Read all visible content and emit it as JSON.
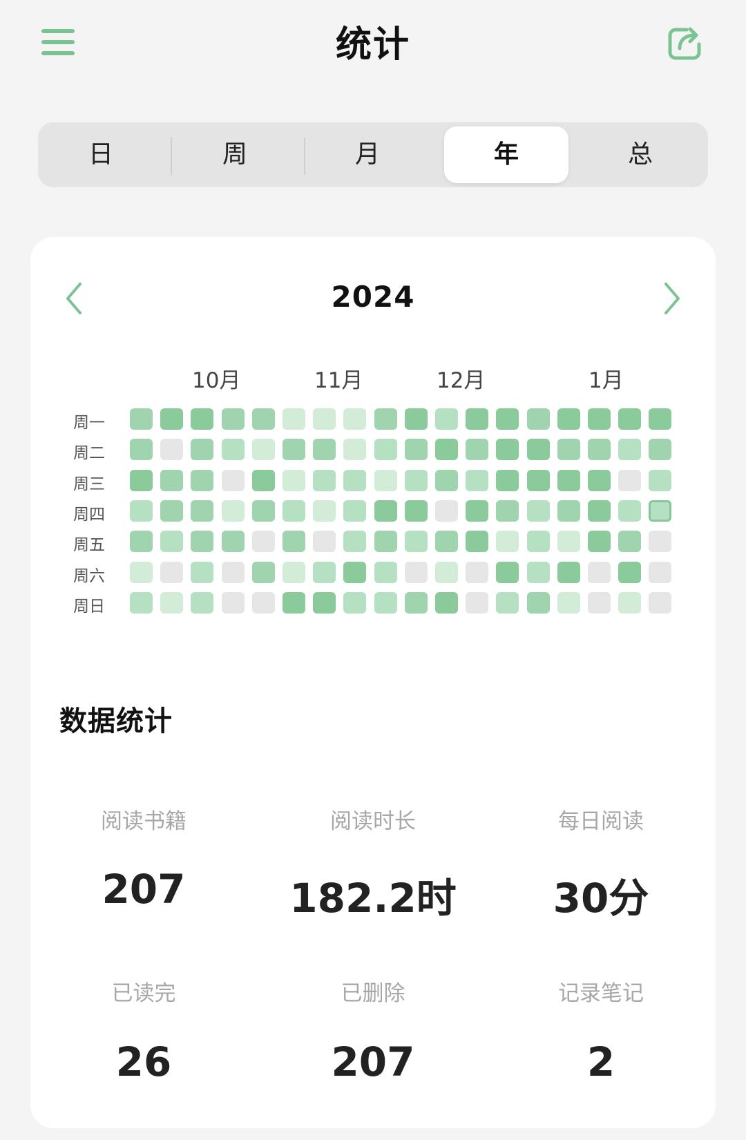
{
  "header": {
    "title": "统计",
    "menu_icon": "hamburger-menu-icon",
    "share_icon": "share-export-icon",
    "accent_color": "#7cc394"
  },
  "period_tabs": [
    {
      "label": "日",
      "active": false
    },
    {
      "label": "周",
      "active": false
    },
    {
      "label": "月",
      "active": false
    },
    {
      "label": "年",
      "active": true
    },
    {
      "label": "总",
      "active": false
    }
  ],
  "calendar": {
    "year": "2024",
    "prev_icon": "chevron-left-icon",
    "next_icon": "chevron-right-icon",
    "months": [
      "10月",
      "11月",
      "12月",
      "1月"
    ],
    "weekdays": [
      "周一",
      "周二",
      "周三",
      "周四",
      "周五",
      "周六",
      "周日"
    ],
    "colors": [
      "#e6e6e6",
      "#d2ecd8",
      "#b5e0c2",
      "#9fd4ae",
      "#8bca9a"
    ],
    "highlight_border": "#86c796",
    "intensity": [
      [
        3,
        4,
        4,
        3,
        3,
        1,
        1,
        1,
        3,
        4,
        2,
        4,
        4,
        3,
        4,
        4,
        4,
        4
      ],
      [
        3,
        0,
        3,
        2,
        1,
        3,
        3,
        1,
        2,
        3,
        4,
        3,
        4,
        4,
        3,
        3,
        2,
        3
      ],
      [
        4,
        3,
        3,
        0,
        4,
        1,
        2,
        2,
        1,
        2,
        3,
        2,
        4,
        4,
        4,
        4,
        0,
        2
      ],
      [
        2,
        3,
        3,
        1,
        3,
        2,
        1,
        2,
        4,
        4,
        0,
        4,
        3,
        2,
        3,
        4,
        2,
        2
      ],
      [
        3,
        2,
        3,
        3,
        0,
        3,
        0,
        2,
        3,
        2,
        3,
        4,
        1,
        2,
        1,
        4,
        3,
        0
      ],
      [
        1,
        0,
        2,
        0,
        3,
        1,
        2,
        4,
        2,
        0,
        1,
        0,
        4,
        2,
        4,
        0,
        4,
        0
      ],
      [
        2,
        1,
        2,
        0,
        0,
        4,
        4,
        2,
        2,
        3,
        4,
        0,
        2,
        3,
        1,
        0,
        1,
        0
      ]
    ]
  },
  "stats": {
    "section_title": "数据统计",
    "items": [
      {
        "label": "阅读书籍",
        "value": "207"
      },
      {
        "label": "阅读时长",
        "value": "182.2时"
      },
      {
        "label": "每日阅读",
        "value": "30分"
      },
      {
        "label": "已读完",
        "value": "26"
      },
      {
        "label": "已删除",
        "value": "207"
      },
      {
        "label": "记录笔记",
        "value": "2"
      }
    ]
  }
}
